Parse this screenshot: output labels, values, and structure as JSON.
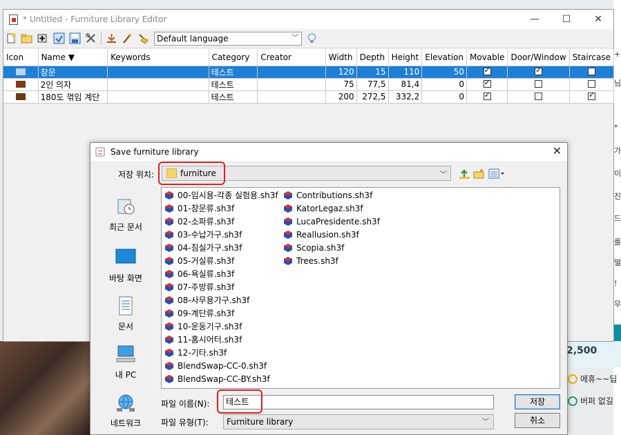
{
  "editor": {
    "title": "* Untitled - Furniture Library Editor",
    "window_buttons": {
      "minimize": "—",
      "maximize": "☐",
      "close": "✕"
    },
    "toolbar": {
      "language": "Default language",
      "icons": [
        "new-file-icon",
        "open-folder-icon",
        "add-furniture-icon",
        "import-icon",
        "save-icon",
        "tools-icon",
        "download-icon",
        "edit-wand-icon",
        "clean-icon",
        "lightbulb-icon"
      ]
    },
    "table": {
      "columns": {
        "icon": "Icon",
        "name": "Name ▼",
        "keywords": "Keywords",
        "category": "Category",
        "creator": "Creator",
        "width": "Width",
        "depth": "Depth",
        "height": "Height",
        "elevation": "Elevation",
        "movable": "Movable",
        "door_window": "Door/Window",
        "staircase": "Staircase"
      },
      "rows": [
        {
          "name": "창문",
          "keywords": "",
          "category": "테스트",
          "creator": "",
          "width": "120",
          "depth": "15",
          "height": "110",
          "elevation": "50",
          "movable": true,
          "door_window": true,
          "staircase": false,
          "selected": true
        },
        {
          "name": "2인 의자",
          "keywords": "",
          "category": "테스트",
          "creator": "",
          "width": "75",
          "depth": "77,5",
          "height": "81,4",
          "elevation": "0",
          "movable": true,
          "door_window": false,
          "staircase": false,
          "selected": false
        },
        {
          "name": "180도 꺾임 계단",
          "keywords": "",
          "category": "테스트",
          "creator": "",
          "width": "200",
          "depth": "272,5",
          "height": "332,2",
          "elevation": "0",
          "movable": true,
          "door_window": false,
          "staircase": true,
          "selected": false
        }
      ]
    }
  },
  "dialog": {
    "title": "Save furniture library",
    "close": "✕",
    "look_in_label": "저장 위치:",
    "look_in_value": "furniture",
    "places": [
      "최근 문서",
      "바탕 화면",
      "문서",
      "내 PC",
      "네트워크"
    ],
    "files_col1": [
      "00-임시용-각종 실험용.sh3f",
      "01-창문류.sh3f",
      "02-소파류.sh3f",
      "03-수납가구.sh3f",
      "04-침실가구.sh3f",
      "05-거실류.sh3f",
      "06-욕실류.sh3f",
      "07-주방류.sh3f",
      "08-사무용가구.sh3f",
      "09-계단류.sh3f",
      "10-운동기구.sh3f",
      "11-홈시어터.sh3f",
      "12-기타.sh3f",
      "BlendSwap-CC-0.sh3f",
      "BlendSwap-CC-BY.sh3f"
    ],
    "files_col2": [
      "Contributions.sh3f",
      "KatorLegaz.sh3f",
      "LucaPresidente.sh3f",
      "Reallusion.sh3f",
      "Scopia.sh3f",
      "Trees.sh3f"
    ],
    "file_name_label": "파일 이름(N):",
    "file_name_value": "테스트",
    "file_type_label": "파일 유형(T):",
    "file_type_value": "Furniture library",
    "save_button": "저장",
    "cancel_button": "취소"
  },
  "background": {
    "right_glyphs": [
      "+",
      "님",
      "*",
      "가",
      "이",
      "진",
      "드",
      "를",
      "떨",
      "!",
      "무"
    ],
    "price": "2,500",
    "tags": [
      "에휴~~딥",
      "버퍼 없길"
    ]
  },
  "colors": {
    "selection": "#1e7fd7",
    "highlight_box": "#e02020",
    "default_button_border": "#2a7ad0"
  }
}
